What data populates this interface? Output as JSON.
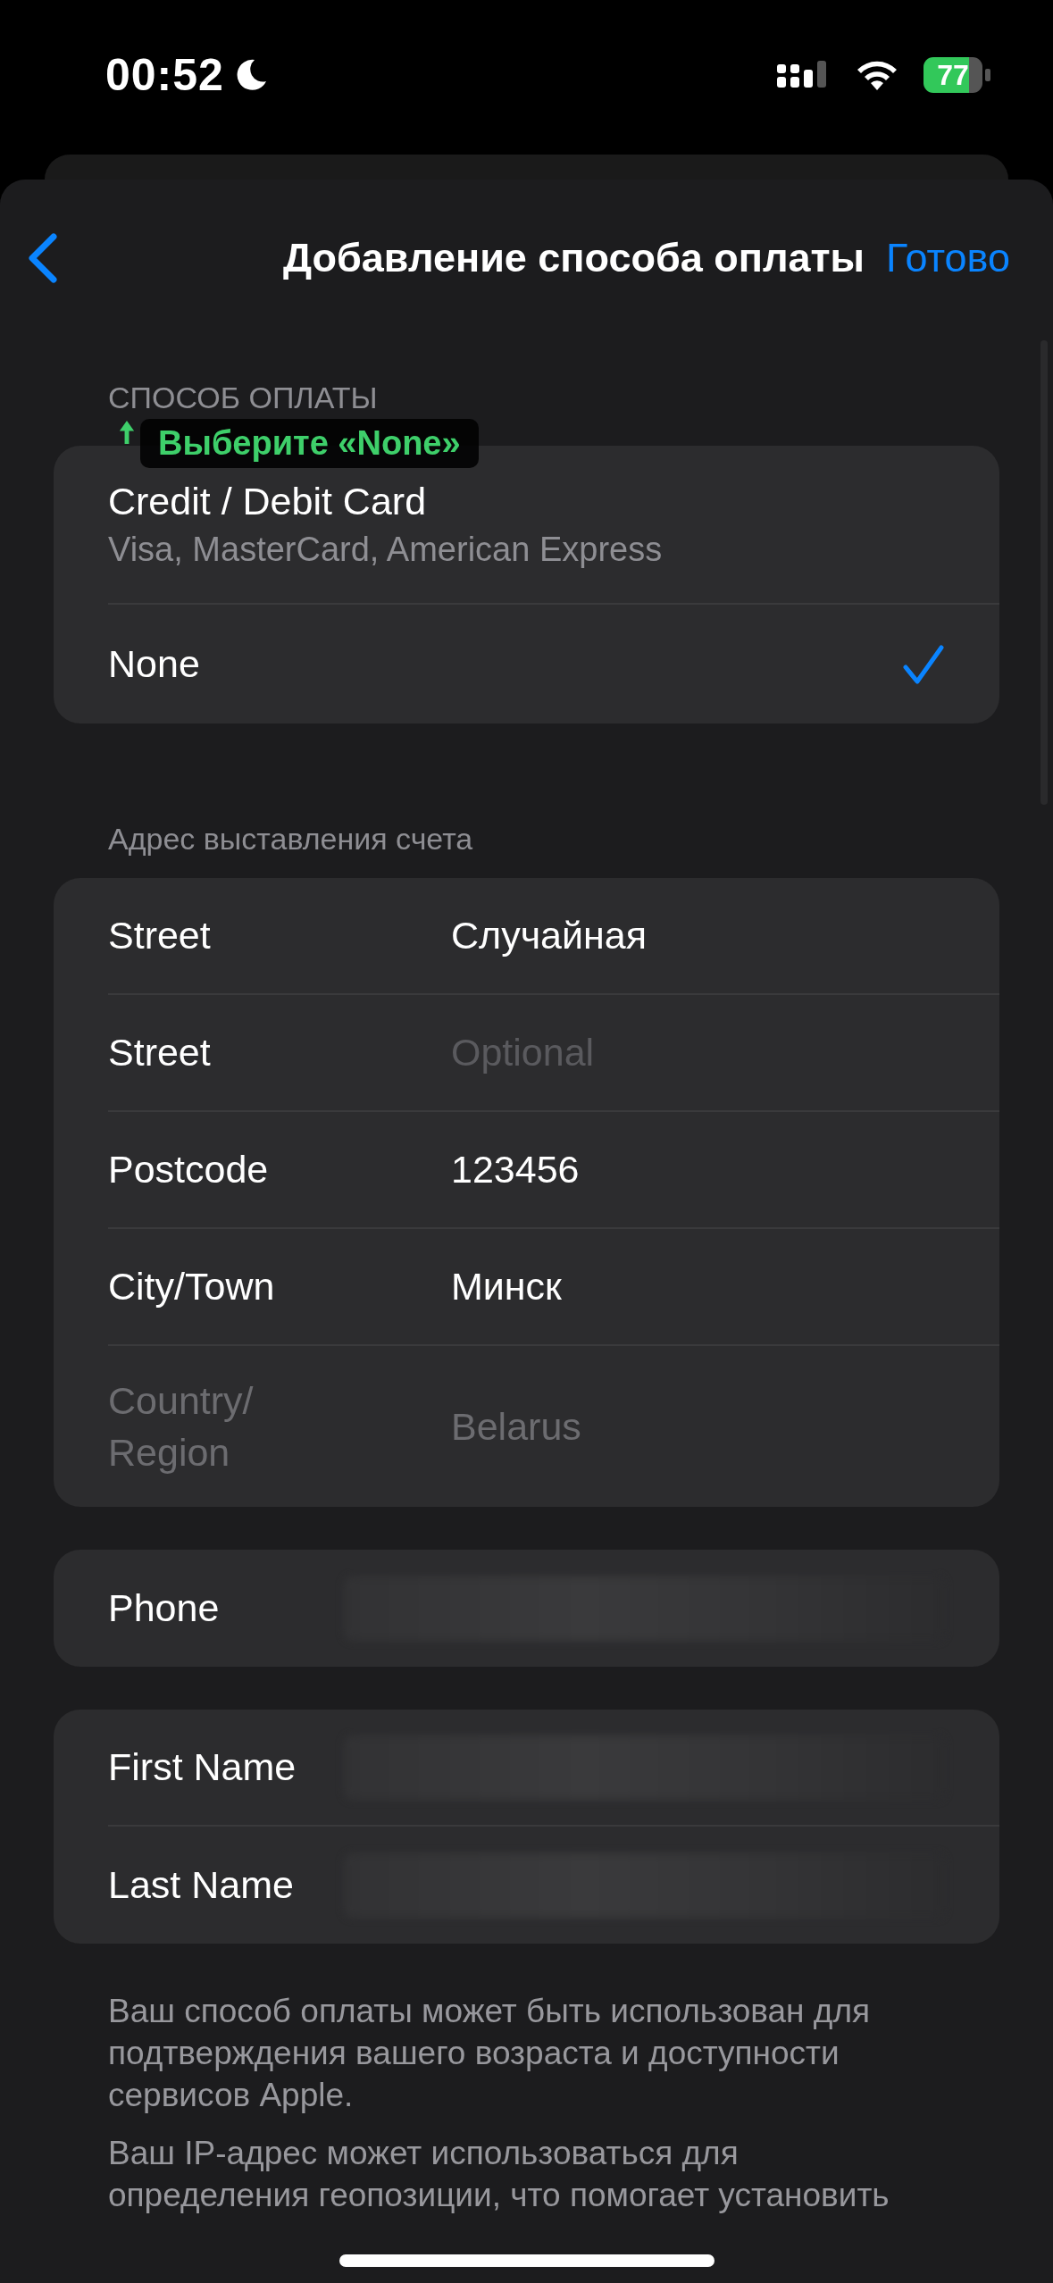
{
  "status_bar": {
    "time": "00:52",
    "battery": "77"
  },
  "nav": {
    "title": "Добавление способа оплаты",
    "done": "Готово"
  },
  "payment": {
    "header": "СПОСОБ ОПЛАТЫ",
    "hint": "Выберите «None»",
    "options": [
      {
        "label": "Credit / Debit Card",
        "subtitle": "Visa, MasterCard, American Express",
        "selected": false
      },
      {
        "label": "None",
        "selected": true
      }
    ]
  },
  "billing": {
    "header": "Адрес выставления счета",
    "fields": [
      {
        "label": "Street",
        "value": "Случайная",
        "disabled": false
      },
      {
        "label": "Street",
        "placeholder": "Optional",
        "disabled": false
      },
      {
        "label": "Postcode",
        "value": "123456",
        "disabled": false
      },
      {
        "label": "City/Town",
        "value": "Минск",
        "disabled": false
      },
      {
        "label": "Country/Region",
        "value": "Belarus",
        "disabled": true
      }
    ]
  },
  "phone": {
    "fields": [
      {
        "label": "Phone",
        "blurred": true
      }
    ]
  },
  "name": {
    "fields": [
      {
        "label": "First Name",
        "blurred": true
      },
      {
        "label": "Last Name",
        "blurred": true
      }
    ]
  },
  "notes": [
    "Ваш способ оплаты может быть использован для подтверждения вашего возраста и доступности сервисов Apple.",
    "Ваш IP-адрес может использоваться для определения геопозиции, что помогает установить"
  ]
}
